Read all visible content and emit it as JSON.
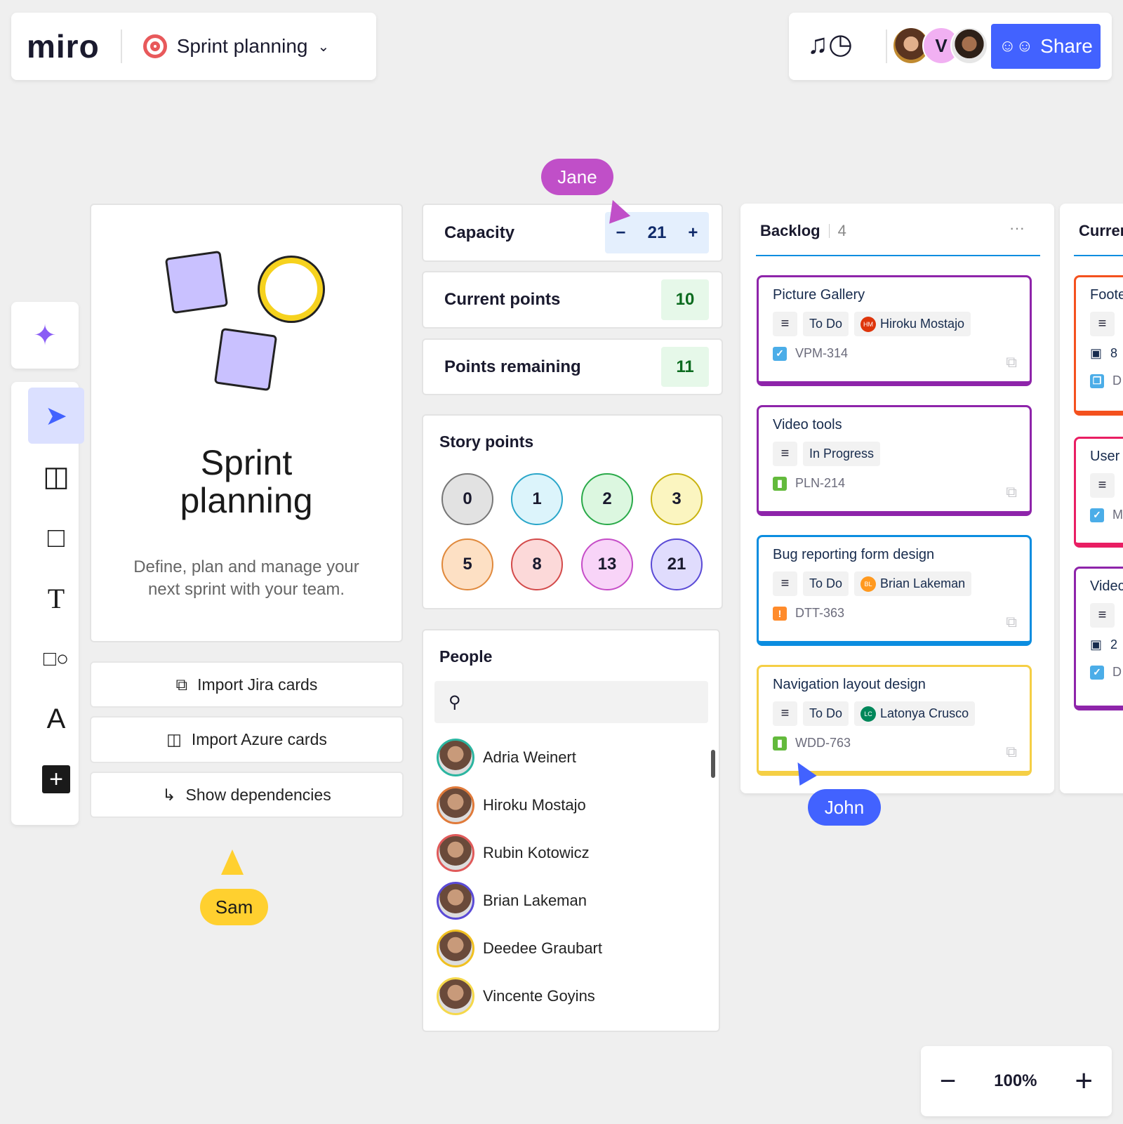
{
  "header": {
    "logo": "miro",
    "board_title": "Sprint planning",
    "share_label": "Share",
    "avatar_initial": "V",
    "accent": "#4262ff"
  },
  "sprint_card": {
    "title": "Sprint planning",
    "description": "Define, plan and manage your next sprint with your team."
  },
  "actions": [
    {
      "label": "Import Jira cards",
      "icon": "jira-icon"
    },
    {
      "label": "Import Azure cards",
      "icon": "azure-icon"
    },
    {
      "label": "Show dependencies",
      "icon": "dependency-icon"
    }
  ],
  "capacity": {
    "label": "Capacity",
    "value": "21",
    "minus": "−",
    "plus": "+"
  },
  "current_points": {
    "label": "Current points",
    "value": "10"
  },
  "points_remaining": {
    "label": "Points remaining",
    "value": "11"
  },
  "story_points": {
    "title": "Story points",
    "values": [
      "0",
      "1",
      "2",
      "3",
      "5",
      "8",
      "13",
      "21"
    ]
  },
  "people": {
    "title": "People",
    "search_placeholder": "",
    "list": [
      "Adria Weinert",
      "Hiroku Mostajo",
      "Rubin Kotowicz",
      "Brian Lakeman",
      "Deedee Graubart",
      "Vincente Goyins"
    ]
  },
  "backlog": {
    "title": "Backlog",
    "count": "4",
    "more": "···",
    "cards": [
      {
        "title": "Picture Gallery",
        "status": "To Do",
        "assignee": "Hiroku Mostajo",
        "initials": "HM",
        "key": "VPM-314",
        "color": "#8e24aa",
        "type_icon": "task-icon"
      },
      {
        "title": "Video tools",
        "status": "In Progress",
        "assignee": "",
        "initials": "",
        "key": "PLN-214",
        "color": "#8e24aa",
        "type_icon": "story-icon"
      },
      {
        "title": "Bug reporting form design",
        "status": "To Do",
        "assignee": "Brian Lakeman",
        "initials": "BL",
        "key": "DTT-363",
        "color": "#0b8de0",
        "type_icon": "bug-icon"
      },
      {
        "title": "Navigation layout design",
        "status": "To Do",
        "assignee": "Latonya Crusco",
        "initials": "LC",
        "key": "WDD-763",
        "color": "#f5cf45",
        "type_icon": "story-icon"
      }
    ]
  },
  "current": {
    "title": "Curren",
    "cards": [
      {
        "title": "Foote",
        "points": "8",
        "key": "D"
      },
      {
        "title": "User",
        "key": "M"
      },
      {
        "title": "Videc",
        "points": "2",
        "key": "D"
      }
    ]
  },
  "cursors": [
    {
      "name": "Jane",
      "color": "#c04fc8"
    },
    {
      "name": "John",
      "color": "#4262ff"
    },
    {
      "name": "Sam",
      "color": "#ffd02f"
    }
  ],
  "zoom": {
    "level": "100%",
    "minus": "−",
    "plus": "+"
  }
}
